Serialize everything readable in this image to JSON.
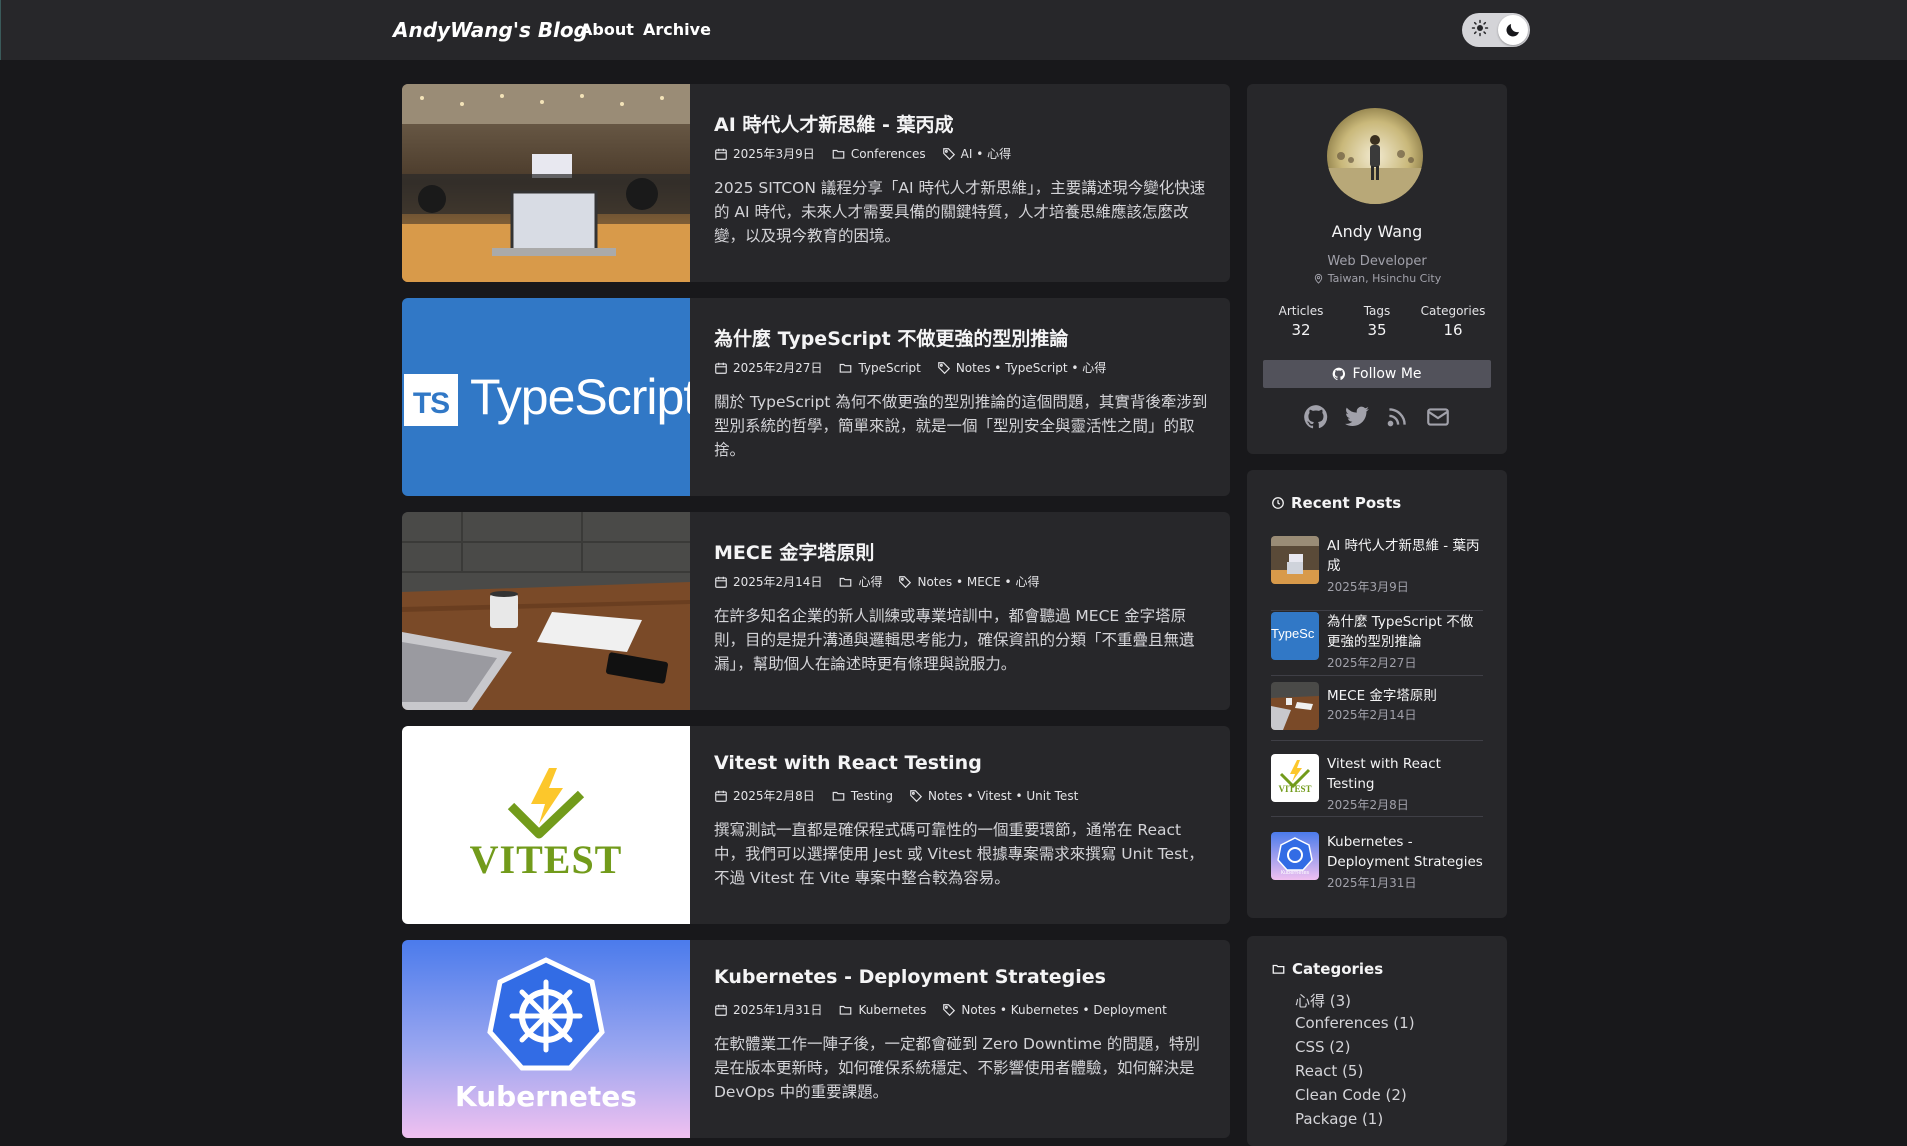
{
  "header": {
    "brand": "AndyWang's Blog",
    "nav": [
      "About",
      "Archive"
    ]
  },
  "posts": [
    {
      "title": "AI 時代人才新思維 - 葉丙成",
      "date": "2025年3月9日",
      "category": "Conferences",
      "tags": "AI • 心得",
      "excerpt": "2025 SITCON 議程分享「AI 時代人才新思維」，主要講述現今變化快速的 AI 時代，未來人才需要具備的關鍵特質，人才培養思維應該怎麼改變，以及現今教育的困境。"
    },
    {
      "title": "為什麼 TypeScript 不做更強的型別推論",
      "date": "2025年2月27日",
      "category": "TypeScript",
      "tags": "Notes • TypeScript • 心得",
      "excerpt": "關於 TypeScript 為何不做更強的型別推論的這個問題，其實背後牽涉到型別系統的哲學，簡單來說，就是一個「型別安全與靈活性之間」的取捨。",
      "thumb_text": "TypeScript",
      "thumb_badge": "TS"
    },
    {
      "title": "MECE 金字塔原則",
      "date": "2025年2月14日",
      "category": "心得",
      "tags": "Notes • MECE • 心得",
      "excerpt": "在許多知名企業的新人訓練或專業培訓中，都會聽過 MECE 金字塔原則，目的是提升溝通與邏輯思考能力，確保資訊的分類「不重疊且無遺漏」，幫助個人在論述時更有條理與說服力。"
    },
    {
      "title": "Vitest with React Testing",
      "date": "2025年2月8日",
      "category": "Testing",
      "tags": "Notes • Vitest • Unit Test",
      "excerpt": "撰寫測試一直都是確保程式碼可靠性的一個重要環節，通常在 React 中，我們可以選擇使用 Jest 或 Vitest 根據專案需求來撰寫 Unit Test，不過 Vitest 在 Vite 專案中整合較為容易。",
      "thumb_text": "VITEST"
    },
    {
      "title": "Kubernetes - Deployment Strategies",
      "date": "2025年1月31日",
      "category": "Kubernetes",
      "tags": "Notes • Kubernetes • Deployment",
      "excerpt": "在軟體業工作一陣子後，一定都會碰到 Zero Downtime 的問題，特別是在版本更新時，如何確保系統穩定、不影響使用者體驗，如何解決是 DevOps 中的重要課題。",
      "thumb_text": "Kubernetes"
    }
  ],
  "profile": {
    "name": "Andy Wang",
    "role": "Web Developer",
    "location": "Taiwan, Hsinchu City",
    "stats": [
      {
        "label": "Articles",
        "value": "32"
      },
      {
        "label": "Tags",
        "value": "35"
      },
      {
        "label": "Categories",
        "value": "16"
      }
    ],
    "follow_label": "Follow Me",
    "social_icons": [
      "github-icon",
      "twitter-icon",
      "rss-icon",
      "mail-icon"
    ]
  },
  "recent": {
    "title": "Recent Posts",
    "items": [
      {
        "title": "AI 時代人才新思維 - 葉丙成",
        "date": "2025年3月9日"
      },
      {
        "title": "為什麼 TypeScript 不做更強的型別推論",
        "date": "2025年2月27日"
      },
      {
        "title": "MECE 金字塔原則",
        "date": "2025年2月14日"
      },
      {
        "title": "Vitest with React Testing",
        "date": "2025年2月8日"
      },
      {
        "title": "Kubernetes - Deployment Strategies",
        "date": "2025年1月31日"
      }
    ],
    "thumb_typescript": "TypeSc",
    "thumb_vitest": "VITEST",
    "thumb_k8s": "Kubernetes"
  },
  "categories": {
    "title": "Categories",
    "items": [
      "心得 (3)",
      "Conferences (1)",
      "CSS (2)",
      "React (5)",
      "Clean Code (2)",
      "Package (1)"
    ]
  },
  "colors": {
    "page_bg": "#18181b",
    "card_bg": "#27272a",
    "typescript_blue": "#3178c6",
    "vitest_yellow": "#fcc72b",
    "vitest_green": "#729b1b"
  }
}
